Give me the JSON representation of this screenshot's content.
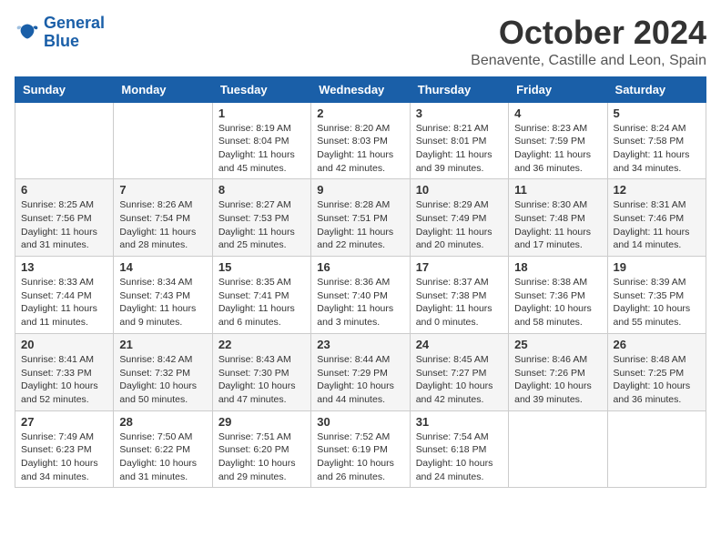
{
  "logo": {
    "line1": "General",
    "line2": "Blue"
  },
  "title": "October 2024",
  "location": "Benavente, Castille and Leon, Spain",
  "weekdays": [
    "Sunday",
    "Monday",
    "Tuesday",
    "Wednesday",
    "Thursday",
    "Friday",
    "Saturday"
  ],
  "weeks": [
    [
      {
        "day": null
      },
      {
        "day": null
      },
      {
        "day": "1",
        "sunrise": "Sunrise: 8:19 AM",
        "sunset": "Sunset: 8:04 PM",
        "daylight": "Daylight: 11 hours and 45 minutes."
      },
      {
        "day": "2",
        "sunrise": "Sunrise: 8:20 AM",
        "sunset": "Sunset: 8:03 PM",
        "daylight": "Daylight: 11 hours and 42 minutes."
      },
      {
        "day": "3",
        "sunrise": "Sunrise: 8:21 AM",
        "sunset": "Sunset: 8:01 PM",
        "daylight": "Daylight: 11 hours and 39 minutes."
      },
      {
        "day": "4",
        "sunrise": "Sunrise: 8:23 AM",
        "sunset": "Sunset: 7:59 PM",
        "daylight": "Daylight: 11 hours and 36 minutes."
      },
      {
        "day": "5",
        "sunrise": "Sunrise: 8:24 AM",
        "sunset": "Sunset: 7:58 PM",
        "daylight": "Daylight: 11 hours and 34 minutes."
      }
    ],
    [
      {
        "day": "6",
        "sunrise": "Sunrise: 8:25 AM",
        "sunset": "Sunset: 7:56 PM",
        "daylight": "Daylight: 11 hours and 31 minutes."
      },
      {
        "day": "7",
        "sunrise": "Sunrise: 8:26 AM",
        "sunset": "Sunset: 7:54 PM",
        "daylight": "Daylight: 11 hours and 28 minutes."
      },
      {
        "day": "8",
        "sunrise": "Sunrise: 8:27 AM",
        "sunset": "Sunset: 7:53 PM",
        "daylight": "Daylight: 11 hours and 25 minutes."
      },
      {
        "day": "9",
        "sunrise": "Sunrise: 8:28 AM",
        "sunset": "Sunset: 7:51 PM",
        "daylight": "Daylight: 11 hours and 22 minutes."
      },
      {
        "day": "10",
        "sunrise": "Sunrise: 8:29 AM",
        "sunset": "Sunset: 7:49 PM",
        "daylight": "Daylight: 11 hours and 20 minutes."
      },
      {
        "day": "11",
        "sunrise": "Sunrise: 8:30 AM",
        "sunset": "Sunset: 7:48 PM",
        "daylight": "Daylight: 11 hours and 17 minutes."
      },
      {
        "day": "12",
        "sunrise": "Sunrise: 8:31 AM",
        "sunset": "Sunset: 7:46 PM",
        "daylight": "Daylight: 11 hours and 14 minutes."
      }
    ],
    [
      {
        "day": "13",
        "sunrise": "Sunrise: 8:33 AM",
        "sunset": "Sunset: 7:44 PM",
        "daylight": "Daylight: 11 hours and 11 minutes."
      },
      {
        "day": "14",
        "sunrise": "Sunrise: 8:34 AM",
        "sunset": "Sunset: 7:43 PM",
        "daylight": "Daylight: 11 hours and 9 minutes."
      },
      {
        "day": "15",
        "sunrise": "Sunrise: 8:35 AM",
        "sunset": "Sunset: 7:41 PM",
        "daylight": "Daylight: 11 hours and 6 minutes."
      },
      {
        "day": "16",
        "sunrise": "Sunrise: 8:36 AM",
        "sunset": "Sunset: 7:40 PM",
        "daylight": "Daylight: 11 hours and 3 minutes."
      },
      {
        "day": "17",
        "sunrise": "Sunrise: 8:37 AM",
        "sunset": "Sunset: 7:38 PM",
        "daylight": "Daylight: 11 hours and 0 minutes."
      },
      {
        "day": "18",
        "sunrise": "Sunrise: 8:38 AM",
        "sunset": "Sunset: 7:36 PM",
        "daylight": "Daylight: 10 hours and 58 minutes."
      },
      {
        "day": "19",
        "sunrise": "Sunrise: 8:39 AM",
        "sunset": "Sunset: 7:35 PM",
        "daylight": "Daylight: 10 hours and 55 minutes."
      }
    ],
    [
      {
        "day": "20",
        "sunrise": "Sunrise: 8:41 AM",
        "sunset": "Sunset: 7:33 PM",
        "daylight": "Daylight: 10 hours and 52 minutes."
      },
      {
        "day": "21",
        "sunrise": "Sunrise: 8:42 AM",
        "sunset": "Sunset: 7:32 PM",
        "daylight": "Daylight: 10 hours and 50 minutes."
      },
      {
        "day": "22",
        "sunrise": "Sunrise: 8:43 AM",
        "sunset": "Sunset: 7:30 PM",
        "daylight": "Daylight: 10 hours and 47 minutes."
      },
      {
        "day": "23",
        "sunrise": "Sunrise: 8:44 AM",
        "sunset": "Sunset: 7:29 PM",
        "daylight": "Daylight: 10 hours and 44 minutes."
      },
      {
        "day": "24",
        "sunrise": "Sunrise: 8:45 AM",
        "sunset": "Sunset: 7:27 PM",
        "daylight": "Daylight: 10 hours and 42 minutes."
      },
      {
        "day": "25",
        "sunrise": "Sunrise: 8:46 AM",
        "sunset": "Sunset: 7:26 PM",
        "daylight": "Daylight: 10 hours and 39 minutes."
      },
      {
        "day": "26",
        "sunrise": "Sunrise: 8:48 AM",
        "sunset": "Sunset: 7:25 PM",
        "daylight": "Daylight: 10 hours and 36 minutes."
      }
    ],
    [
      {
        "day": "27",
        "sunrise": "Sunrise: 7:49 AM",
        "sunset": "Sunset: 6:23 PM",
        "daylight": "Daylight: 10 hours and 34 minutes."
      },
      {
        "day": "28",
        "sunrise": "Sunrise: 7:50 AM",
        "sunset": "Sunset: 6:22 PM",
        "daylight": "Daylight: 10 hours and 31 minutes."
      },
      {
        "day": "29",
        "sunrise": "Sunrise: 7:51 AM",
        "sunset": "Sunset: 6:20 PM",
        "daylight": "Daylight: 10 hours and 29 minutes."
      },
      {
        "day": "30",
        "sunrise": "Sunrise: 7:52 AM",
        "sunset": "Sunset: 6:19 PM",
        "daylight": "Daylight: 10 hours and 26 minutes."
      },
      {
        "day": "31",
        "sunrise": "Sunrise: 7:54 AM",
        "sunset": "Sunset: 6:18 PM",
        "daylight": "Daylight: 10 hours and 24 minutes."
      },
      {
        "day": null
      },
      {
        "day": null
      }
    ]
  ]
}
